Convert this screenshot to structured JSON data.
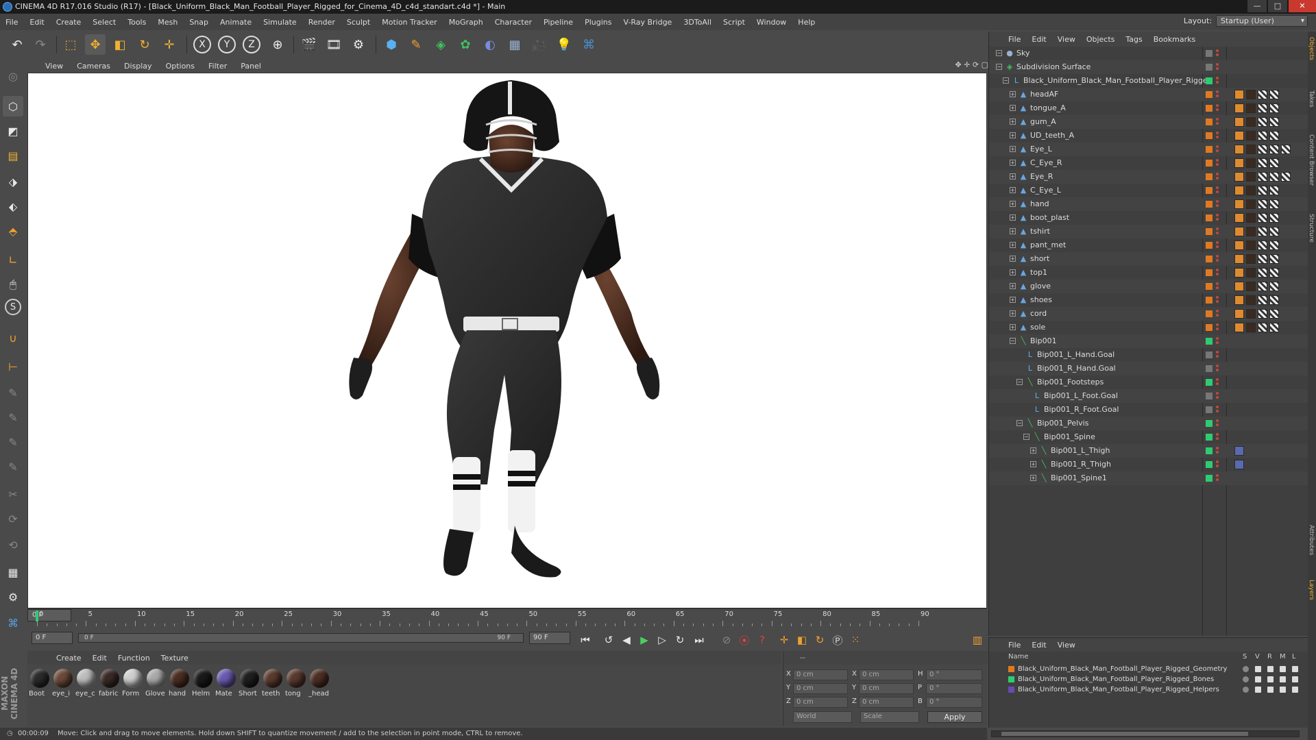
{
  "window": {
    "title": "CINEMA 4D R17.016 Studio (R17) - [Black_Uniform_Black_Man_Football_Player_Rigged_for_Cinema_4D_c4d_standart.c4d *] - Main",
    "controls": [
      "—",
      "□",
      "✕"
    ]
  },
  "menubar": {
    "items": [
      "File",
      "Edit",
      "Create",
      "Select",
      "Tools",
      "Mesh",
      "Snap",
      "Animate",
      "Simulate",
      "Render",
      "Sculpt",
      "Motion Tracker",
      "MoGraph",
      "Character",
      "Pipeline",
      "Plugins",
      "V-Ray Bridge",
      "3DToAll",
      "Script",
      "Window",
      "Help"
    ]
  },
  "layout": {
    "label": "Layout:",
    "value": "Startup (User)"
  },
  "toolbar": {
    "axis_x": "X",
    "axis_y": "Y",
    "axis_z": "Z"
  },
  "viewport": {
    "menu": [
      "View",
      "Cameras",
      "Display",
      "Options",
      "Filter",
      "Panel"
    ]
  },
  "timeline": {
    "ticks": [
      "0",
      "5",
      "10",
      "15",
      "20",
      "25",
      "30",
      "35",
      "40",
      "45",
      "50",
      "55",
      "60",
      "65",
      "70",
      "75",
      "80",
      "85",
      "90"
    ],
    "current_frame": "0 F"
  },
  "transport": {
    "start": "0 F",
    "range_start": "0 F",
    "range_end": "90 F",
    "end": "90 F"
  },
  "materials": {
    "menu": [
      "Create",
      "Edit",
      "Function",
      "Texture"
    ],
    "items": [
      {
        "label": "Boot",
        "color": "#2b2b2b"
      },
      {
        "label": "eye_i",
        "color": "#6b4a3a"
      },
      {
        "label": "eye_c",
        "color": "#bdbdbd"
      },
      {
        "label": "fabric",
        "color": "#3a2a26"
      },
      {
        "label": "Form",
        "color": "#cfcfcf"
      },
      {
        "label": "Glove",
        "color": "#a9a9a9"
      },
      {
        "label": "hand",
        "color": "#4a2e22"
      },
      {
        "label": "Helm",
        "color": "#1a1a1a"
      },
      {
        "label": "Mate",
        "color": "#6a5ab0"
      },
      {
        "label": "Short",
        "color": "#1f1f1f"
      },
      {
        "label": "teeth",
        "color": "#5a3a2e"
      },
      {
        "label": "tong",
        "color": "#5a3a30"
      },
      {
        "label": "_head",
        "color": "#4d2f24"
      }
    ]
  },
  "coords": {
    "header": "--",
    "rows": [
      {
        "axis": "X",
        "pos": "0 cm",
        "saxis": "X",
        "size": "0 cm",
        "raxis": "H",
        "rot": "0 °"
      },
      {
        "axis": "Y",
        "pos": "0 cm",
        "saxis": "Y",
        "size": "0 cm",
        "raxis": "P",
        "rot": "0 °"
      },
      {
        "axis": "Z",
        "pos": "0 cm",
        "saxis": "Z",
        "size": "0 cm",
        "raxis": "B",
        "rot": "0 °"
      }
    ],
    "world": "World",
    "scale": "Scale",
    "apply": "Apply"
  },
  "status": {
    "time": "00:00:09",
    "message": "Move: Click and drag to move elements. Hold down SHIFT to quantize movement / add to the selection in point mode, CTRL to remove."
  },
  "object_manager": {
    "menu": [
      "File",
      "Edit",
      "View",
      "Objects",
      "Tags",
      "Bookmarks"
    ],
    "objects": [
      {
        "name": "Sky",
        "indent": 0,
        "type": "sky",
        "layer": "",
        "tags": 0
      },
      {
        "name": "Subdivision Surface",
        "indent": 0,
        "type": "subd",
        "layer": "",
        "tags": 0
      },
      {
        "name": "Black_Uniform_Black_Man_Football_Player_Rigged",
        "indent": 1,
        "type": "null",
        "layer": "#2ecc71",
        "tags": 0
      },
      {
        "name": "headAF",
        "indent": 2,
        "type": "mesh",
        "layer": "#e07a22",
        "tags": 4
      },
      {
        "name": "tongue_A",
        "indent": 2,
        "type": "mesh",
        "layer": "#e07a22",
        "tags": 4
      },
      {
        "name": "gum_A",
        "indent": 2,
        "type": "mesh",
        "layer": "#e07a22",
        "tags": 4
      },
      {
        "name": "UD_teeth_A",
        "indent": 2,
        "type": "mesh",
        "layer": "#e07a22",
        "tags": 4
      },
      {
        "name": "Eye_L",
        "indent": 2,
        "type": "mesh",
        "layer": "#e07a22",
        "tags": 5
      },
      {
        "name": "C_Eye_R",
        "indent": 2,
        "type": "mesh",
        "layer": "#e07a22",
        "tags": 4
      },
      {
        "name": "Eye_R",
        "indent": 2,
        "type": "mesh",
        "layer": "#e07a22",
        "tags": 5
      },
      {
        "name": "C_Eye_L",
        "indent": 2,
        "type": "mesh",
        "layer": "#e07a22",
        "tags": 4
      },
      {
        "name": "hand",
        "indent": 2,
        "type": "mesh",
        "layer": "#e07a22",
        "tags": 4
      },
      {
        "name": "boot_plast",
        "indent": 2,
        "type": "mesh",
        "layer": "#e07a22",
        "tags": 4
      },
      {
        "name": "tshirt",
        "indent": 2,
        "type": "mesh",
        "layer": "#e07a22",
        "tags": 4
      },
      {
        "name": "pant_met",
        "indent": 2,
        "type": "mesh",
        "layer": "#e07a22",
        "tags": 4
      },
      {
        "name": "short",
        "indent": 2,
        "type": "mesh",
        "layer": "#e07a22",
        "tags": 4
      },
      {
        "name": "top1",
        "indent": 2,
        "type": "mesh",
        "layer": "#e07a22",
        "tags": 4
      },
      {
        "name": "glove",
        "indent": 2,
        "type": "mesh",
        "layer": "#e07a22",
        "tags": 4
      },
      {
        "name": "shoes",
        "indent": 2,
        "type": "mesh",
        "layer": "#e07a22",
        "tags": 4
      },
      {
        "name": "cord",
        "indent": 2,
        "type": "mesh",
        "layer": "#e07a22",
        "tags": 4
      },
      {
        "name": "sole",
        "indent": 2,
        "type": "mesh",
        "layer": "#e07a22",
        "tags": 4
      },
      {
        "name": "Bip001",
        "indent": 2,
        "type": "bone",
        "layer": "#2ecc71",
        "tags": 0
      },
      {
        "name": "Bip001_L_Hand.Goal",
        "indent": 3,
        "type": "null",
        "layer": "",
        "tags": 0
      },
      {
        "name": "Bip001_R_Hand.Goal",
        "indent": 3,
        "type": "null",
        "layer": "",
        "tags": 0
      },
      {
        "name": "Bip001_Footsteps",
        "indent": 3,
        "type": "bone",
        "layer": "#2ecc71",
        "tags": 0
      },
      {
        "name": "Bip001_L_Foot.Goal",
        "indent": 4,
        "type": "null",
        "layer": "",
        "tags": 0
      },
      {
        "name": "Bip001_R_Foot.Goal",
        "indent": 4,
        "type": "null",
        "layer": "",
        "tags": 0
      },
      {
        "name": "Bip001_Pelvis",
        "indent": 3,
        "type": "bone",
        "layer": "#2ecc71",
        "tags": 0
      },
      {
        "name": "Bip001_Spine",
        "indent": 4,
        "type": "bone",
        "layer": "#2ecc71",
        "tags": 0
      },
      {
        "name": "Bip001_L_Thigh",
        "indent": 5,
        "type": "bone",
        "layer": "#2ecc71",
        "tags": 1
      },
      {
        "name": "Bip001_R_Thigh",
        "indent": 5,
        "type": "bone",
        "layer": "#2ecc71",
        "tags": 1
      },
      {
        "name": "Bip001_Spine1",
        "indent": 5,
        "type": "bone",
        "layer": "#2ecc71",
        "tags": 0
      }
    ]
  },
  "layer_manager": {
    "menu": [
      "File",
      "Edit",
      "View"
    ],
    "columns": [
      "Name",
      "S",
      "V",
      "R",
      "M",
      "L"
    ],
    "layers": [
      {
        "name": "Black_Uniform_Black_Man_Football_Player_Rigged_Geometry",
        "color": "#e07a22"
      },
      {
        "name": "Black_Uniform_Black_Man_Football_Player_Rigged_Bones",
        "color": "#2ecc71"
      },
      {
        "name": "Black_Uniform_Black_Man_Football_Player_Rigged_Helpers",
        "color": "#6a4ab0"
      }
    ]
  },
  "right_tabs": [
    "Objects",
    "Takes",
    "Content Browser",
    "Structure",
    "Attributes",
    "Layers"
  ],
  "branding": "MAXON CINEMA 4D"
}
